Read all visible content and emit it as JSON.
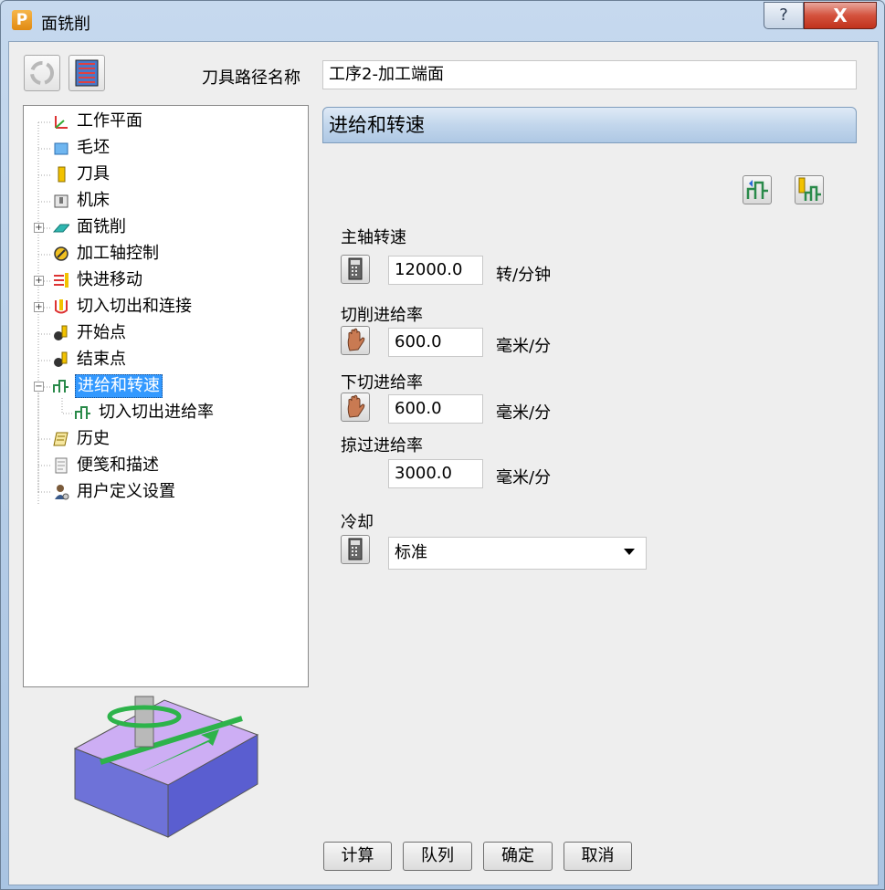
{
  "window": {
    "title": "面铣削",
    "logo_letter": "P",
    "help_label": "?",
    "close_label": "X"
  },
  "toolbar": {
    "path_name_label": "刀具路径名称",
    "path_name_value": "工序2-加工端面"
  },
  "tree": {
    "items": [
      {
        "label": "工作平面",
        "icon": "workplane-icon"
      },
      {
        "label": "毛坯",
        "icon": "block-icon"
      },
      {
        "label": "刀具",
        "icon": "tool-icon"
      },
      {
        "label": "机床",
        "icon": "machine-icon"
      },
      {
        "label": "面铣削",
        "icon": "face-mill-icon"
      },
      {
        "label": "加工轴控制",
        "icon": "axis-control-icon"
      },
      {
        "label": "快进移动",
        "icon": "rapid-move-icon"
      },
      {
        "label": "切入切出和连接",
        "icon": "leads-links-icon"
      },
      {
        "label": "开始点",
        "icon": "start-point-icon"
      },
      {
        "label": "结束点",
        "icon": "end-point-icon"
      },
      {
        "label": "进给和转速",
        "icon": "feeds-speeds-icon"
      },
      {
        "label": "切入切出进给率",
        "icon": "lead-feed-icon"
      },
      {
        "label": "历史",
        "icon": "history-icon"
      },
      {
        "label": "便笺和描述",
        "icon": "notes-icon"
      },
      {
        "label": "用户定义设置",
        "icon": "user-settings-icon"
      }
    ]
  },
  "panel": {
    "header": "进给和转速",
    "spindle_label": "主轴转速",
    "spindle_value": "12000.0",
    "spindle_unit": "转/分钟",
    "cut_feed_label": "切削进给率",
    "cut_feed_value": "600.0",
    "cut_feed_unit": "毫米/分",
    "plunge_feed_label": "下切进给率",
    "plunge_feed_value": "600.0",
    "plunge_feed_unit": "毫米/分",
    "skim_feed_label": "掠过进给率",
    "skim_feed_value": "3000.0",
    "skim_feed_unit": "毫米/分",
    "coolant_label": "冷却",
    "coolant_value": "标准"
  },
  "buttons": {
    "calculate": "计算",
    "queue": "队列",
    "ok": "确定",
    "cancel": "取消"
  },
  "colors": {
    "selection": "#3399ff",
    "header_gradient": "#c2d6ec",
    "close_red": "#c0321c"
  }
}
